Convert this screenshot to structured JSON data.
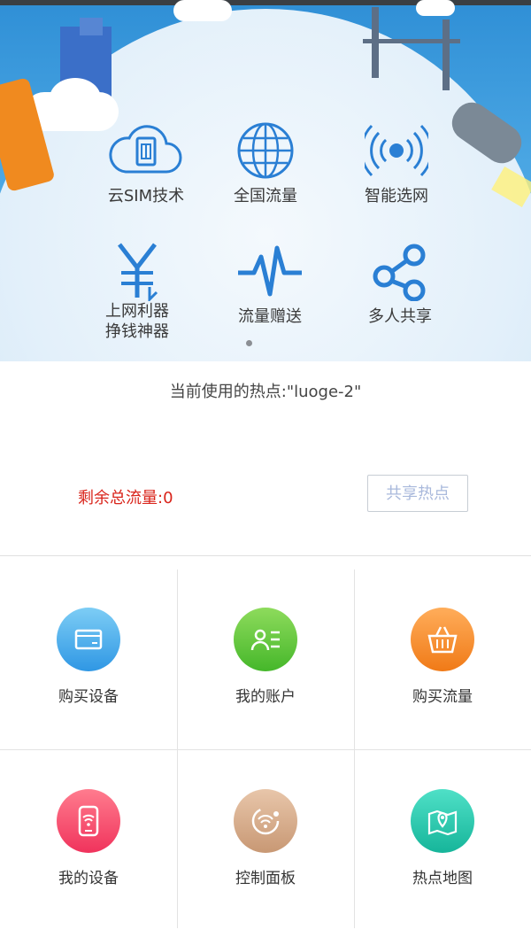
{
  "banner": {
    "features": [
      {
        "icon": "cloud-sim-icon",
        "label": "云SIM技术"
      },
      {
        "icon": "globe-icon",
        "label": "全国流量"
      },
      {
        "icon": "signal-broadcast-icon",
        "label": "智能选网"
      },
      {
        "icon": "yen-icon",
        "label": "上网利器\n挣钱神器"
      },
      {
        "icon": "pulse-icon",
        "label": "流量赠送"
      },
      {
        "icon": "share-icon",
        "label": "多人共享"
      }
    ],
    "pager_count": 1,
    "active_page": 0
  },
  "hotspot": {
    "current_text": "当前使用的热点:\"luoge-2\"",
    "remaining_text": "剩余总流量:0",
    "share_button": "共享热点"
  },
  "grid": {
    "items": [
      {
        "icon": "wallet-icon",
        "label": "购买设备",
        "color_from": "#7dcdf5",
        "color_to": "#2f97e4"
      },
      {
        "icon": "contact-card-icon",
        "label": "我的账户",
        "color_from": "#8edb5c",
        "color_to": "#45b72a"
      },
      {
        "icon": "basket-icon",
        "label": "购买流量",
        "color_from": "#ffad5a",
        "color_to": "#f07a17"
      },
      {
        "icon": "wifi-phone-icon",
        "label": "我的设备",
        "color_from": "#ff7c8e",
        "color_to": "#f0335c"
      },
      {
        "icon": "control-panel-icon",
        "label": "控制面板",
        "color_from": "#e8c6aa",
        "color_to": "#c89874"
      },
      {
        "icon": "map-pin-icon",
        "label": "热点地图",
        "color_from": "#4fe0c7",
        "color_to": "#16b59a"
      }
    ]
  },
  "colors": {
    "remaining": "#d9241b",
    "icon_blue": "#2a7fd4"
  }
}
